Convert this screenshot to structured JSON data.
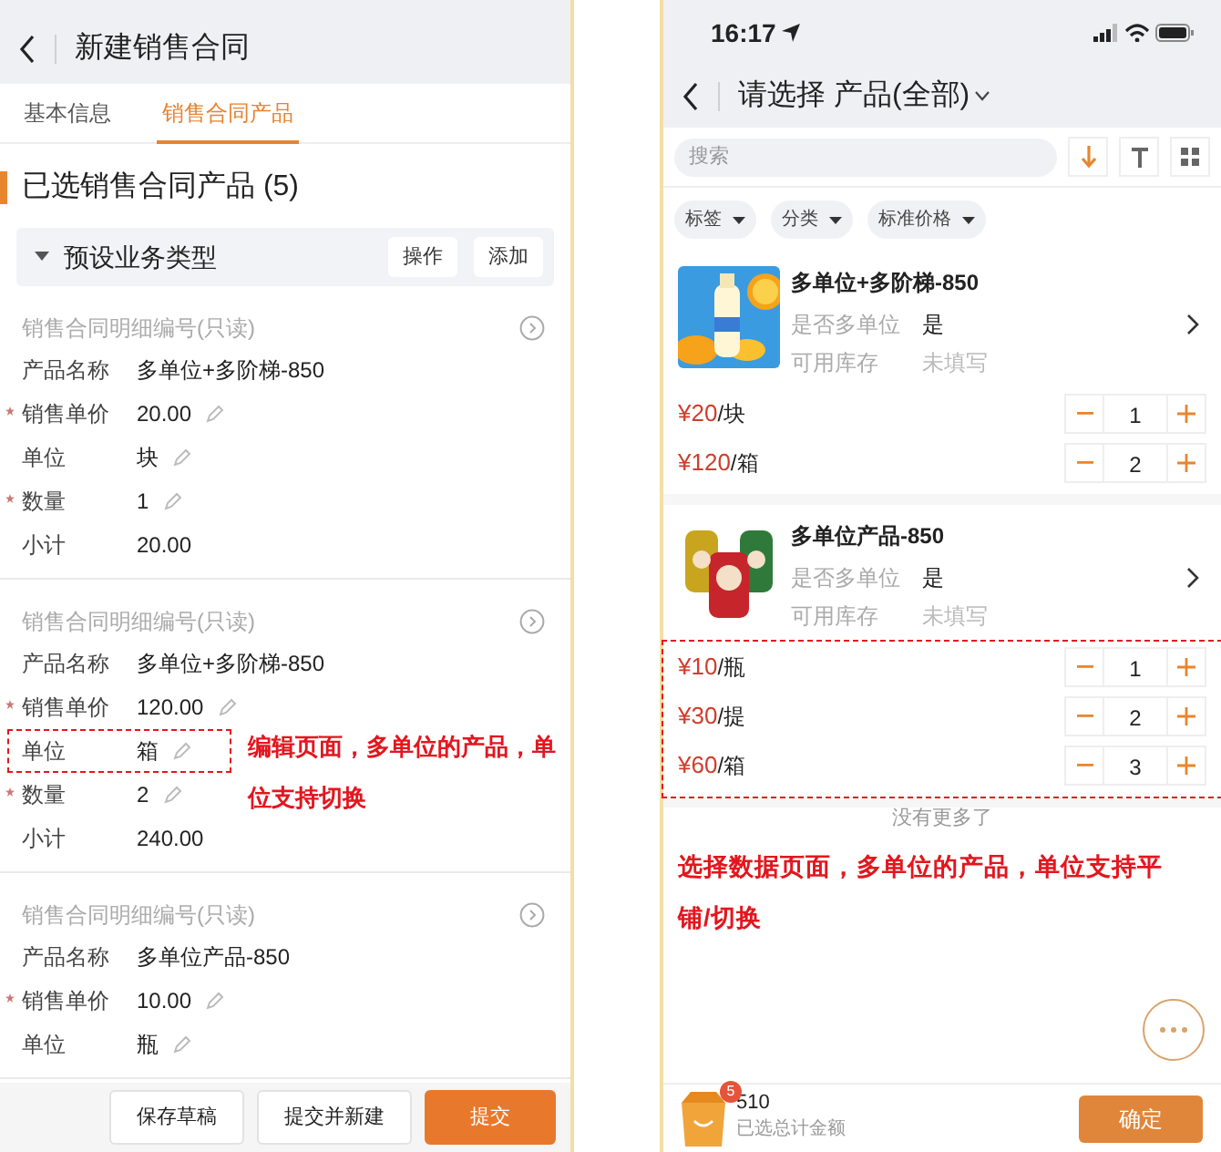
{
  "left": {
    "title": "新建销售合同",
    "tabs": [
      {
        "label": "基本信息",
        "selected": false
      },
      {
        "label": "销售合同产品",
        "selected": true
      }
    ],
    "section_title": "已选销售合同产品 (5)",
    "group": {
      "title": "预设业务类型",
      "expanded": true,
      "buttons": [
        "操作",
        "添加"
      ]
    },
    "records": [
      {
        "header": "销售合同明细编号(只读)",
        "fields": [
          {
            "label": "产品名称",
            "value": "多单位+多阶梯-850",
            "required": false,
            "editable": false,
            "highlighted": false
          },
          {
            "label": "销售单价",
            "value": "20.00",
            "required": true,
            "editable": true,
            "highlighted": false
          },
          {
            "label": "单位",
            "value": "块",
            "required": false,
            "editable": true,
            "highlighted": false
          },
          {
            "label": "数量",
            "value": "1",
            "required": true,
            "editable": true,
            "highlighted": false
          },
          {
            "label": "小计",
            "value": "20.00",
            "required": false,
            "editable": false,
            "highlighted": false
          }
        ]
      },
      {
        "header": "销售合同明细编号(只读)",
        "fields": [
          {
            "label": "产品名称",
            "value": "多单位+多阶梯-850",
            "required": false,
            "editable": false,
            "highlighted": false
          },
          {
            "label": "销售单价",
            "value": "120.00",
            "required": true,
            "editable": true,
            "highlighted": false
          },
          {
            "label": "单位",
            "value": "箱",
            "required": false,
            "editable": true,
            "highlighted": true
          },
          {
            "label": "数量",
            "value": "2",
            "required": true,
            "editable": true,
            "highlighted": false
          },
          {
            "label": "小计",
            "value": "240.00",
            "required": false,
            "editable": false,
            "highlighted": false
          }
        ]
      },
      {
        "header": "销售合同明细编号(只读)",
        "fields": [
          {
            "label": "产品名称",
            "value": "多单位产品-850",
            "required": false,
            "editable": false,
            "highlighted": false
          },
          {
            "label": "销售单价",
            "value": "10.00",
            "required": true,
            "editable": true,
            "highlighted": false
          },
          {
            "label": "单位",
            "value": "瓶",
            "required": false,
            "editable": true,
            "highlighted": false
          }
        ]
      }
    ],
    "annotation": "编辑页面，多单位的产品，单位支持切换",
    "footer_buttons": [
      {
        "label": "保存草稿",
        "primary": false
      },
      {
        "label": "提交并新建",
        "primary": false
      },
      {
        "label": "提交",
        "primary": true
      }
    ]
  },
  "right": {
    "status_time": "16:17",
    "title": "请选择 产品(全部)",
    "search": {
      "placeholder": "搜索"
    },
    "filters": [
      "标签",
      "分类",
      "标准价格"
    ],
    "products": [
      {
        "name": "多单位+多阶梯-850",
        "highlighted": false,
        "fields": [
          {
            "label": "是否多单位",
            "value": "是",
            "filled": true
          },
          {
            "label": "可用库存",
            "value": "未填写",
            "filled": false
          }
        ],
        "prices": [
          {
            "price": "¥20",
            "unit": "/块",
            "quantity": "1"
          },
          {
            "price": "¥120",
            "unit": "/箱",
            "quantity": "2"
          }
        ]
      },
      {
        "name": "多单位产品-850",
        "highlighted": true,
        "fields": [
          {
            "label": "是否多单位",
            "value": "是",
            "filled": true
          },
          {
            "label": "可用库存",
            "value": "未填写",
            "filled": false
          }
        ],
        "prices": [
          {
            "price": "¥10",
            "unit": "/瓶",
            "quantity": "1"
          },
          {
            "price": "¥30",
            "unit": "/提",
            "quantity": "2"
          },
          {
            "price": "¥60",
            "unit": "/箱",
            "quantity": "3"
          }
        ]
      }
    ],
    "end_text": "没有更多了",
    "annotation": "选择数据页面，多单位的产品，单位支持平铺/切换",
    "cart": {
      "badge": "5",
      "total": "510",
      "total_label": "已选总计金额"
    },
    "confirm_button": "确定"
  }
}
